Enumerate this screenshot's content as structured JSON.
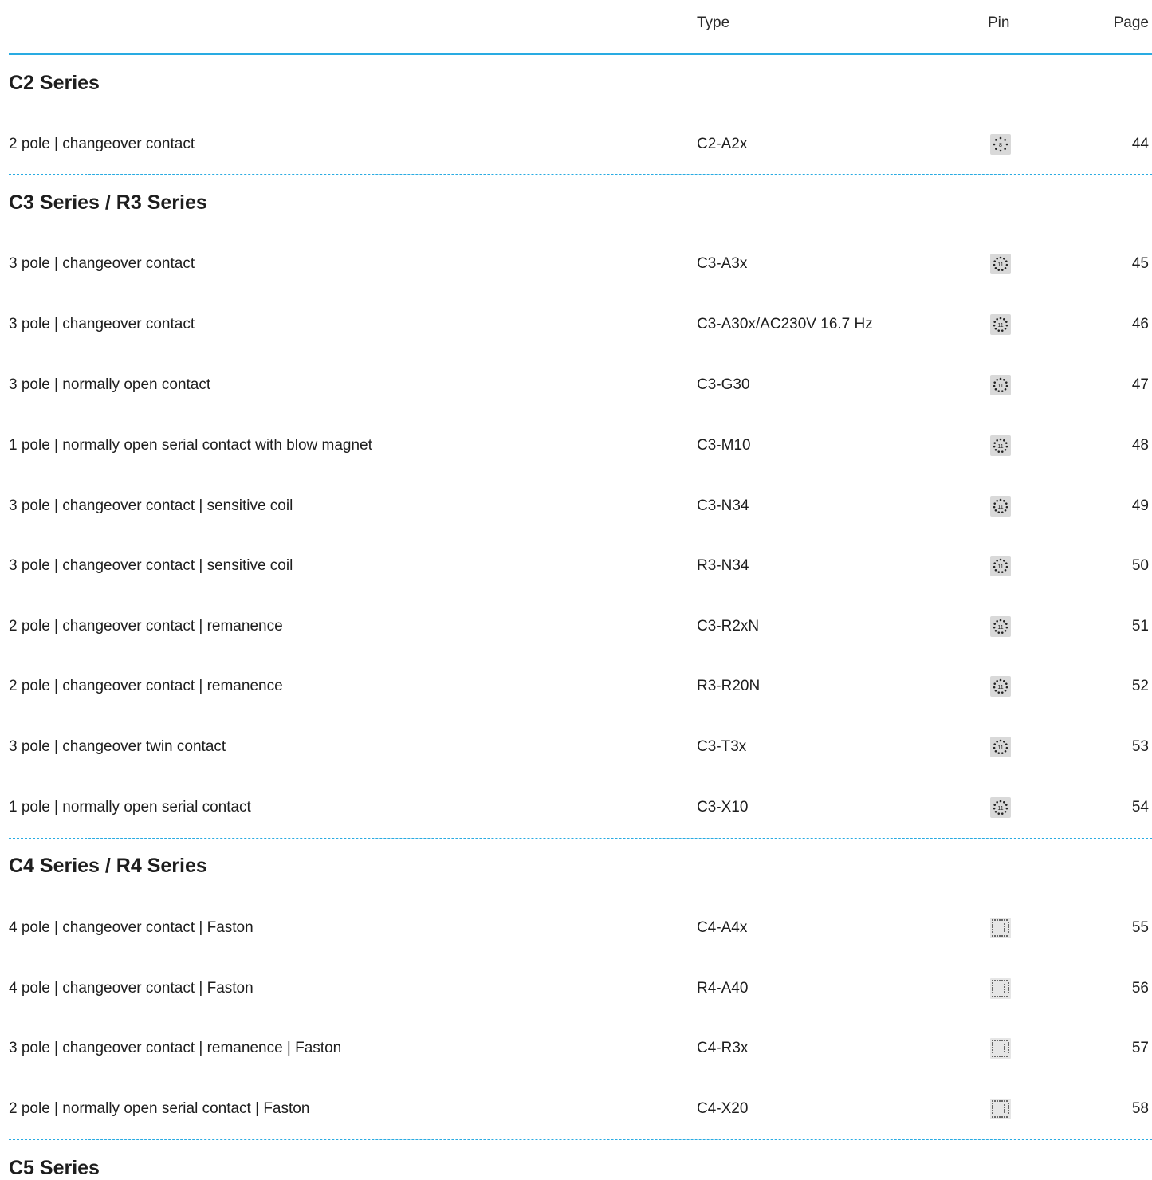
{
  "header": {
    "type": "Type",
    "pin": "Pin",
    "page": "Page"
  },
  "sections": [
    {
      "title": "C2 Series",
      "rows": [
        {
          "desc": "2 pole | changeover contact",
          "type": "C2-A2x",
          "pin": "8-pin-round-icon",
          "page": "44"
        }
      ]
    },
    {
      "title": "C3 Series / R3 Series",
      "rows": [
        {
          "desc": "3 pole | changeover contact",
          "type": "C3-A3x",
          "pin": "11-pin-round-icon",
          "page": "45"
        },
        {
          "desc": "3 pole | changeover contact",
          "type": "C3-A30x/AC230V 16.7 Hz",
          "pin": "11-pin-round-icon",
          "page": "46"
        },
        {
          "desc": "3 pole | normally open contact",
          "type": "C3-G30",
          "pin": "11-pin-round-icon",
          "page": "47"
        },
        {
          "desc": "1 pole | normally open serial contact with blow magnet",
          "type": "C3-M10",
          "pin": "11-pin-round-icon",
          "page": "48"
        },
        {
          "desc": "3 pole | changeover contact | sensitive coil",
          "type": "C3-N34",
          "pin": "11-pin-round-icon",
          "page": "49"
        },
        {
          "desc": "3 pole | changeover contact | sensitive coil",
          "type": "R3-N34",
          "pin": "11-pin-round-icon",
          "page": "50"
        },
        {
          "desc": "2 pole | changeover contact | remanence",
          "type": "C3-R2xN",
          "pin": "11-pin-round-icon",
          "page": "51"
        },
        {
          "desc": "2 pole | changeover contact | remanence",
          "type": "R3-R20N",
          "pin": "11-pin-round-icon",
          "page": "52"
        },
        {
          "desc": "3 pole | changeover twin contact",
          "type": "C3-T3x",
          "pin": "11-pin-round-icon",
          "page": "53"
        },
        {
          "desc": "1 pole | normally open serial contact",
          "type": "C3-X10",
          "pin": "11-pin-round-icon",
          "page": "54"
        }
      ]
    },
    {
      "title": "C4 Series / R4 Series",
      "rows": [
        {
          "desc": "4 pole | changeover contact | Faston",
          "type": "C4-A4x",
          "pin": "faston-square-icon",
          "page": "55"
        },
        {
          "desc": "4 pole | changeover contact | Faston",
          "type": "R4-A40",
          "pin": "faston-square-icon",
          "page": "56"
        },
        {
          "desc": "3 pole | changeover contact | remanence | Faston",
          "type": "C4-R3x",
          "pin": "faston-square-icon",
          "page": "57"
        },
        {
          "desc": "2 pole | normally open serial contact | Faston",
          "type": "C4-X20",
          "pin": "faston-square-icon",
          "page": "58"
        }
      ]
    },
    {
      "title": "C5 Series",
      "rows": []
    }
  ]
}
